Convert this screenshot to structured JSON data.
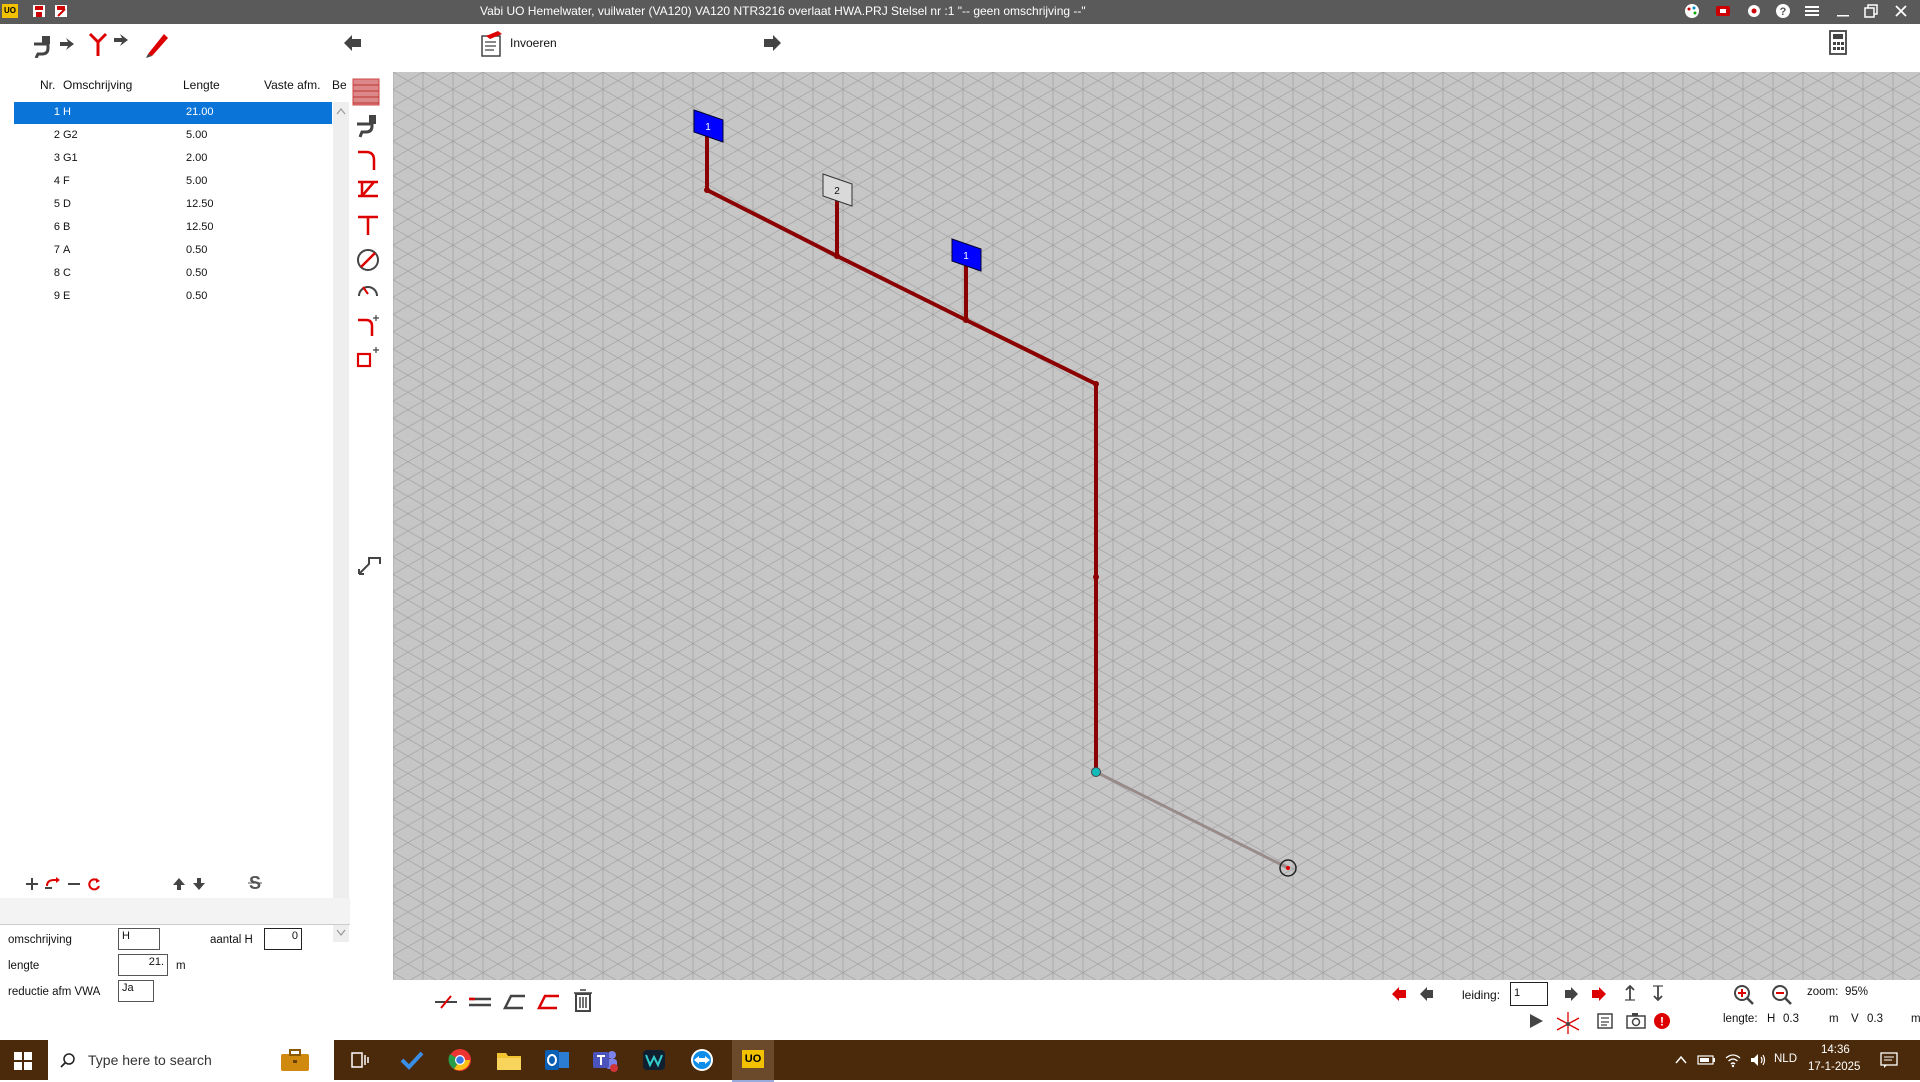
{
  "titlebar": {
    "title": "Vabi UO Hemelwater, vuilwater (VA120)  VA120 NTR3216 overlaat HWA.PRJ      Stelsel nr   :1  \"-- geen omschrijving --\"",
    "app_badge": "UO"
  },
  "toolbar": {
    "invoeren_label": "Invoeren"
  },
  "table": {
    "headers": [
      "Nr.",
      "Omschrijving",
      "Lengte",
      "Vaste afm.",
      "Be"
    ],
    "rows": [
      {
        "nr": "1",
        "omschrijving": "H",
        "lengte": "21.00"
      },
      {
        "nr": "2",
        "omschrijving": "G2",
        "lengte": "5.00"
      },
      {
        "nr": "3",
        "omschrijving": "G1",
        "lengte": "2.00"
      },
      {
        "nr": "4",
        "omschrijving": "F",
        "lengte": "5.00"
      },
      {
        "nr": "5",
        "omschrijving": "D",
        "lengte": "12.50"
      },
      {
        "nr": "6",
        "omschrijving": "B",
        "lengte": "12.50"
      },
      {
        "nr": "7",
        "omschrijving": "A",
        "lengte": "0.50"
      },
      {
        "nr": "8",
        "omschrijving": "C",
        "lengte": "0.50"
      },
      {
        "nr": "9",
        "omschrijving": "E",
        "lengte": "0.50"
      }
    ]
  },
  "form": {
    "omschrijving_label": "omschrijving",
    "omschrijving_value": "H",
    "aantal_h_label": "aantal H",
    "aantal_h_value": "0",
    "lengte_label": "lengte",
    "lengte_value": "21.",
    "lengte_unit": "m",
    "reductie_label": "reductie afm VWA",
    "reductie_value": "Ja"
  },
  "canvas": {
    "node_labels": [
      "1",
      "2",
      "1"
    ],
    "colors": {
      "pipe": "#8b0000",
      "grey_pipe": "#9a8a8a",
      "grid_bg": "#c6c6c6",
      "marker_blue": "#0000ff"
    }
  },
  "bottombar": {
    "leiding_label": "leiding:",
    "leiding_value": "1",
    "zoom_label": "zoom:",
    "zoom_value": "95%",
    "lengte_label": "lengte:",
    "h_label": "H",
    "h_value": "0.3",
    "m_label": "m",
    "v_label": "V",
    "v_value": "0.3",
    "m2_label": "m"
  },
  "taskbar": {
    "search_placeholder": "Type here to search",
    "lang": "NLD",
    "time": "14:36",
    "date": "17-1-2025",
    "uo_label": "UO"
  }
}
